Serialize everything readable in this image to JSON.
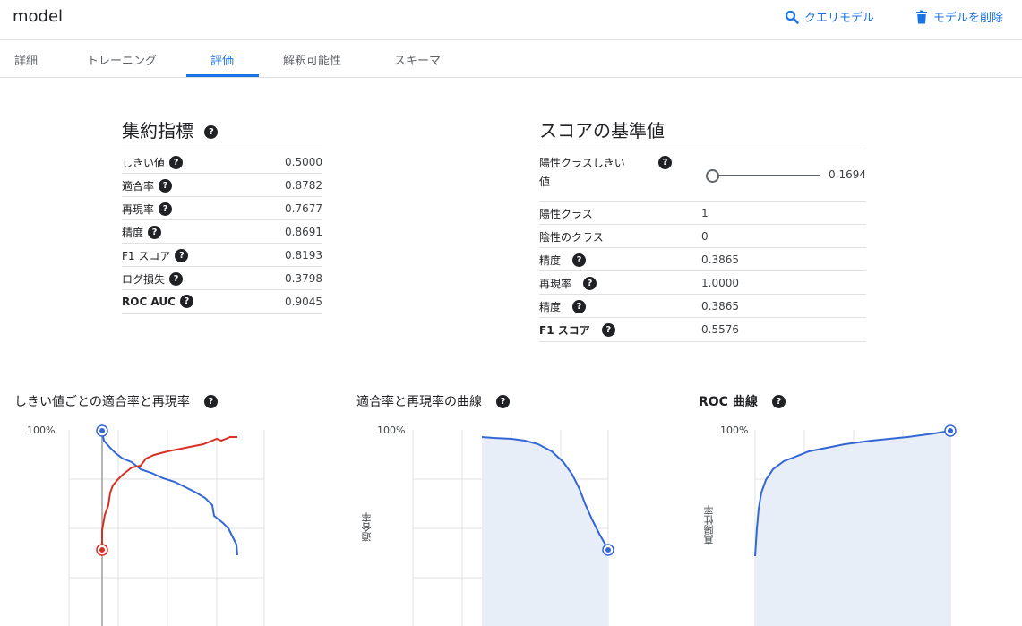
{
  "header": {
    "title": "model",
    "query_label": "クエリモデル",
    "delete_label": "モデルを削除"
  },
  "tabs": [
    "詳細",
    "トレーニング",
    "評価",
    "解釈可能性",
    "スキーマ"
  ],
  "active_tab": "評価",
  "aggregate": {
    "title": "集約指標",
    "rows": [
      {
        "label": "しきい値",
        "value": "0.5000"
      },
      {
        "label": "適合率",
        "value": "0.8782"
      },
      {
        "label": "再現率",
        "value": "0.7677"
      },
      {
        "label": "精度",
        "value": "0.8691"
      },
      {
        "label": "F1 スコア",
        "value": "0.8193"
      },
      {
        "label": "ログ損失",
        "value": "0.3798"
      },
      {
        "label": "ROC AUC",
        "value": "0.9045"
      }
    ]
  },
  "score": {
    "title": "スコアの基準値",
    "threshold_label_1": "陽性クラスしきい",
    "threshold_label_2": "値",
    "threshold_value": "0.1694",
    "rows": [
      {
        "label": "陽性クラス",
        "value": "1"
      },
      {
        "label": "陰性のクラス",
        "value": "0"
      },
      {
        "label": "精度",
        "value": "0.3865"
      },
      {
        "label": "再現率",
        "value": "1.0000"
      },
      {
        "label": "精度",
        "value": "0.3865"
      },
      {
        "label": "F1 スコア",
        "value": "0.5576"
      }
    ]
  },
  "charts": {
    "threshold": {
      "title": "しきい値ごとの適合率と再現率",
      "ytop": "100%"
    },
    "pr": {
      "title": "適合率と再現率の曲線",
      "ytop": "100%",
      "ylabel": "適合率"
    },
    "roc": {
      "title": "ROC 曲線",
      "ytop": "100%",
      "ylabel": "真陽性率"
    }
  },
  "colors": {
    "accent": "#1a73e8",
    "precision_line": "#3367d6",
    "recall_line": "#d93025",
    "area_fill": "#e8eef8"
  }
}
